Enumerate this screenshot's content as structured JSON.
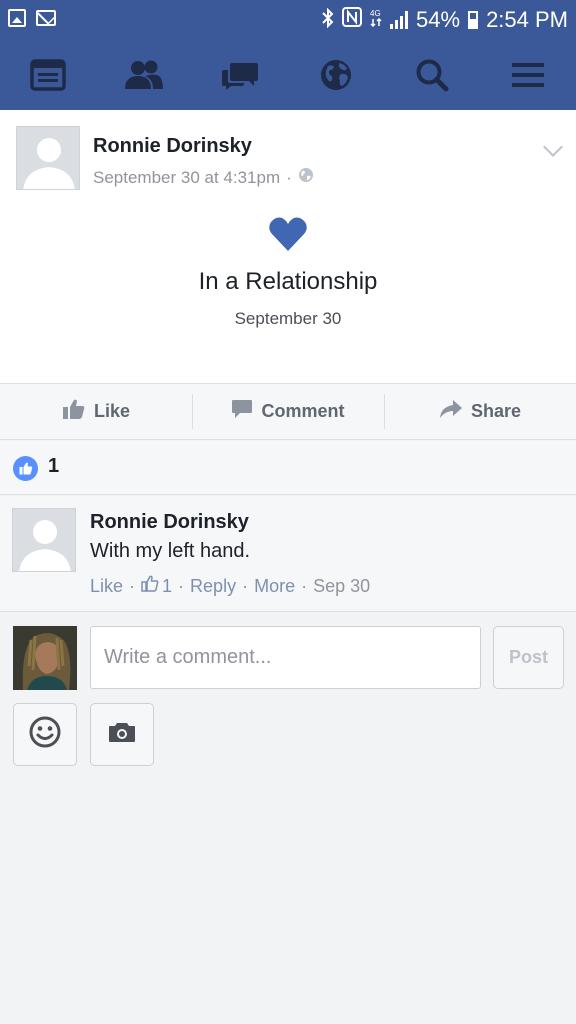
{
  "status_bar": {
    "battery": "54%",
    "time": "2:54 PM",
    "icons": [
      "image-notification-icon",
      "mail-notification-icon",
      "bluetooth-icon",
      "nfc-icon",
      "data-4g-icon",
      "signal-icon",
      "battery-icon"
    ]
  },
  "nav": {
    "items": [
      "news-feed-icon",
      "friend-requests-icon",
      "messages-icon",
      "notifications-globe-icon",
      "search-icon",
      "menu-icon"
    ]
  },
  "post": {
    "author": "Ronnie Dorinsky",
    "timestamp": "September 30 at 4:31pm",
    "separator": "·",
    "privacy_icon": "public-globe-icon",
    "event_icon": "heart-icon",
    "event_title": "In a Relationship",
    "event_date": "September 30"
  },
  "actions": {
    "like": "Like",
    "comment": "Comment",
    "share": "Share"
  },
  "reactions": {
    "count": "1"
  },
  "comment": {
    "author": "Ronnie Dorinsky",
    "text": "With my left hand.",
    "like": "Like",
    "sep": "·",
    "like_count": "1",
    "reply": "Reply",
    "more": "More",
    "time": "Sep 30"
  },
  "composer": {
    "placeholder": "Write a comment...",
    "value": "",
    "post_label": "Post"
  },
  "colors": {
    "brand": "#3b5998",
    "like_badge": "#5890ff",
    "link": "#7e8fb0"
  }
}
